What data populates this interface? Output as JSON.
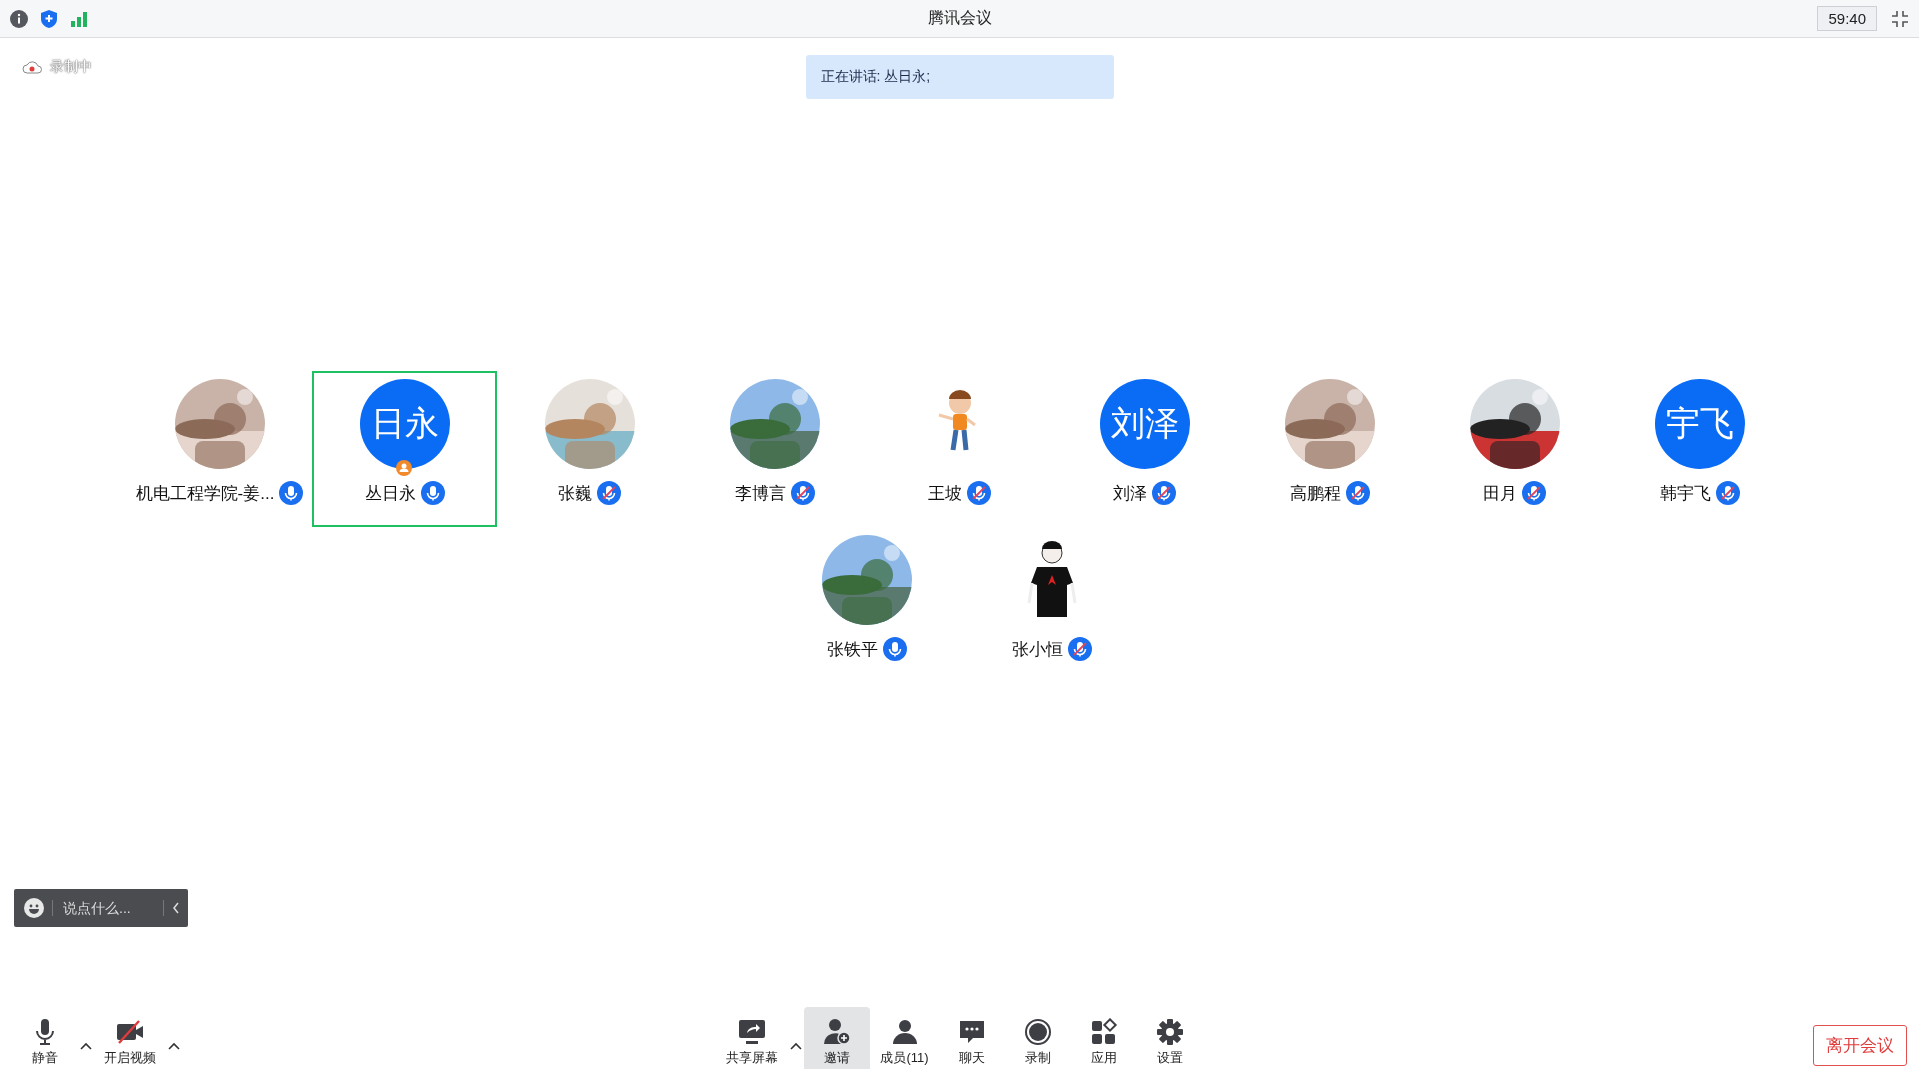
{
  "window": {
    "title": "腾讯会议",
    "timer": "59:40"
  },
  "recording": {
    "label": "录制中"
  },
  "speaking_banner": {
    "text": "正在讲话: 丛日永;"
  },
  "participants": [
    {
      "name": "机电工程学院-姜...",
      "muted": false,
      "speaking": false,
      "host": false
    },
    {
      "name": "丛日永",
      "avatar": {
        "kind": "initials",
        "text": "日永"
      },
      "muted": false,
      "speaking": true,
      "host": true
    },
    {
      "name": "张巍",
      "muted": true,
      "speaking": false,
      "host": false
    },
    {
      "name": "李博言",
      "muted": true,
      "speaking": false,
      "host": false
    },
    {
      "name": "王坡",
      "avatar": {
        "kind": "cartoon"
      },
      "muted": true,
      "speaking": false,
      "host": false
    },
    {
      "name": "刘泽",
      "avatar": {
        "kind": "initials",
        "text": "刘泽"
      },
      "muted": true,
      "speaking": false,
      "host": false
    },
    {
      "name": "高鹏程",
      "muted": true,
      "speaking": false,
      "host": false
    },
    {
      "name": "田月",
      "muted": true,
      "speaking": false,
      "host": false
    },
    {
      "name": "韩宇飞",
      "avatar": {
        "kind": "initials",
        "text": "宇飞"
      },
      "muted": true,
      "speaking": false,
      "host": false
    },
    {
      "name": "张铁平",
      "muted": false,
      "speaking": false,
      "host": false
    },
    {
      "name": "张小恒",
      "avatar": {
        "kind": "figure"
      },
      "muted": true,
      "speaking": false,
      "host": false
    }
  ],
  "chat_input": {
    "placeholder": "说点什么..."
  },
  "toolbar_left": [
    {
      "kind": "mic",
      "label": "静音",
      "has_menu": true
    },
    {
      "kind": "video",
      "label": "开启视频",
      "has_menu": true
    }
  ],
  "toolbar_center": [
    {
      "kind": "share",
      "label": "共享屏幕",
      "has_menu": true,
      "selected": false
    },
    {
      "kind": "invite",
      "label": "邀请",
      "has_menu": false,
      "selected": true
    },
    {
      "kind": "members",
      "label": "成员(11)",
      "has_menu": false,
      "selected": false
    },
    {
      "kind": "chat",
      "label": "聊天",
      "has_menu": false,
      "selected": false
    },
    {
      "kind": "record",
      "label": "录制",
      "has_menu": false,
      "selected": false
    },
    {
      "kind": "apps",
      "label": "应用",
      "has_menu": false,
      "selected": false
    },
    {
      "kind": "settings",
      "label": "设置",
      "has_menu": false,
      "selected": false
    }
  ],
  "leave_button": {
    "label": "离开会议"
  }
}
